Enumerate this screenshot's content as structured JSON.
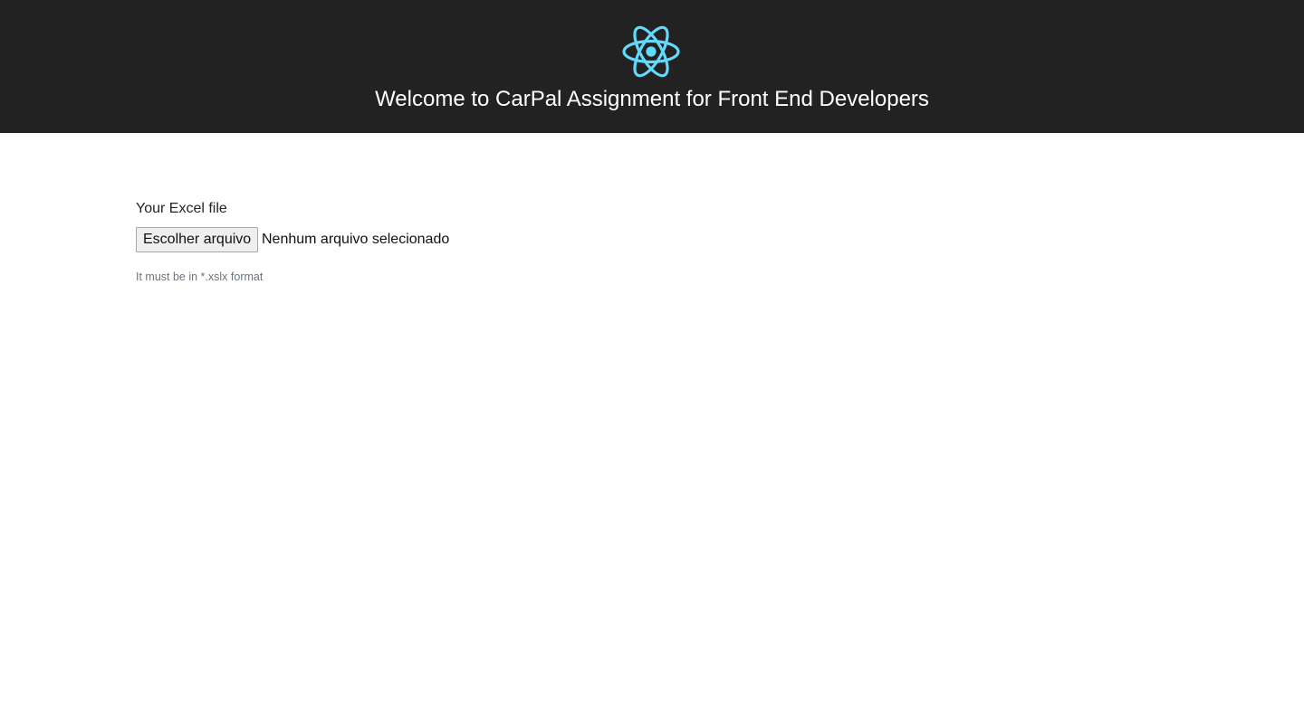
{
  "header": {
    "logo_icon": "react-atom-icon",
    "logo_color": "#61dafb",
    "background_color": "#222222",
    "title": "Welcome to CarPal Assignment for Front End Developers"
  },
  "upload_form": {
    "label": "Your Excel file",
    "choose_button_label": "Escolher arquivo",
    "file_status": "Nenhum arquivo selecionado",
    "help_text": "It must be in *.xslx format"
  }
}
